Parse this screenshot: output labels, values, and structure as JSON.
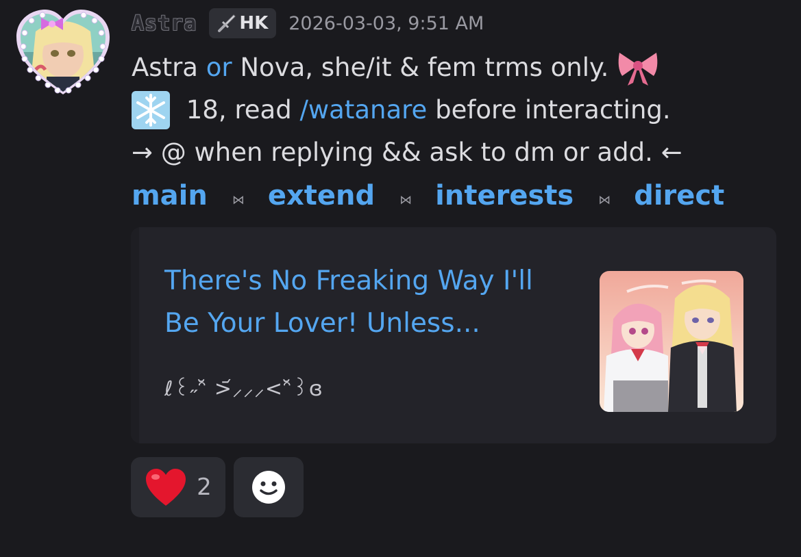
{
  "message": {
    "username": "Astra",
    "tag": {
      "icon": "sword-icon",
      "label": "HK"
    },
    "timestamp": "2026-03-03, 9:51 AM",
    "lines": [
      {
        "parts": [
          "Astra ",
          "or",
          " Nova, she/it & fem trms only."
        ],
        "emoji_end": "ribbon-bow-icon"
      },
      {
        "emoji_start": "snowflake-icon",
        "parts": [
          " 18, read ",
          "/watanare",
          " before interacting."
        ]
      },
      {
        "text": "→ @ when replying && ask to dm or add. ←"
      }
    ],
    "nav_links": [
      "main",
      "extend",
      "interests",
      "direct"
    ],
    "nav_separator": "⋈"
  },
  "embed": {
    "title": "There's No Freaking Way I'll Be Your Lover! Unless...",
    "description": "ℓ꒰˶ᵔ̆ >᷄⸝⸝⸝<ᵔ̆꒱ɞ",
    "thumbnail": "anime-thumbnail-image"
  },
  "reactions": [
    {
      "emoji": "❤️",
      "count": "2",
      "icon": "heart-emoji-icon"
    },
    {
      "icon": "add-reaction-icon"
    }
  ],
  "colors": {
    "background": "#1a1a1e",
    "link": "#54a6f0",
    "embed_bg": "#232329",
    "reaction_bg": "#2b2c32"
  }
}
